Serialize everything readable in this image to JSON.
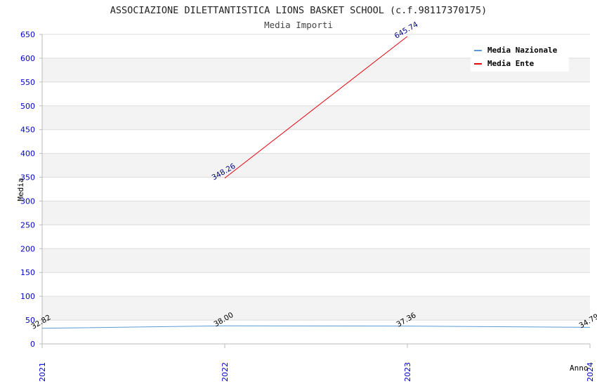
{
  "chart_data": {
    "type": "line",
    "title": "ASSOCIAZIONE DILETTANTISTICA LIONS BASKET SCHOOL (c.f.98117370175)",
    "subtitle": "Media Importi",
    "xlabel": "Anno",
    "ylabel": "Media",
    "ylim": [
      0,
      650
    ],
    "yticks": [
      0,
      50,
      100,
      150,
      200,
      250,
      300,
      350,
      400,
      450,
      500,
      550,
      600,
      650
    ],
    "categories": [
      "2021",
      "2022",
      "2023",
      "2024"
    ],
    "grid": true,
    "legend_position": "top-right",
    "series": [
      {
        "name": "Media Nazionale",
        "color": "#5b9bd5",
        "x": [
          "2021",
          "2022",
          "2023",
          "2024"
        ],
        "values": [
          32.82,
          38.0,
          37.36,
          34.79
        ],
        "labels": [
          "32.82",
          "38.00",
          "37.36",
          "34.79"
        ],
        "label_color": "#000000"
      },
      {
        "name": "Media Ente",
        "color": "#e8000b",
        "x": [
          "2022",
          "2023"
        ],
        "values": [
          348.26,
          645.74
        ],
        "labels": [
          "348.26",
          "645.74"
        ],
        "label_color": "#00008b"
      }
    ]
  },
  "colors": {
    "axis_text": "#0000cc",
    "band": "#f3f3f3",
    "grid": "#dddddd"
  }
}
